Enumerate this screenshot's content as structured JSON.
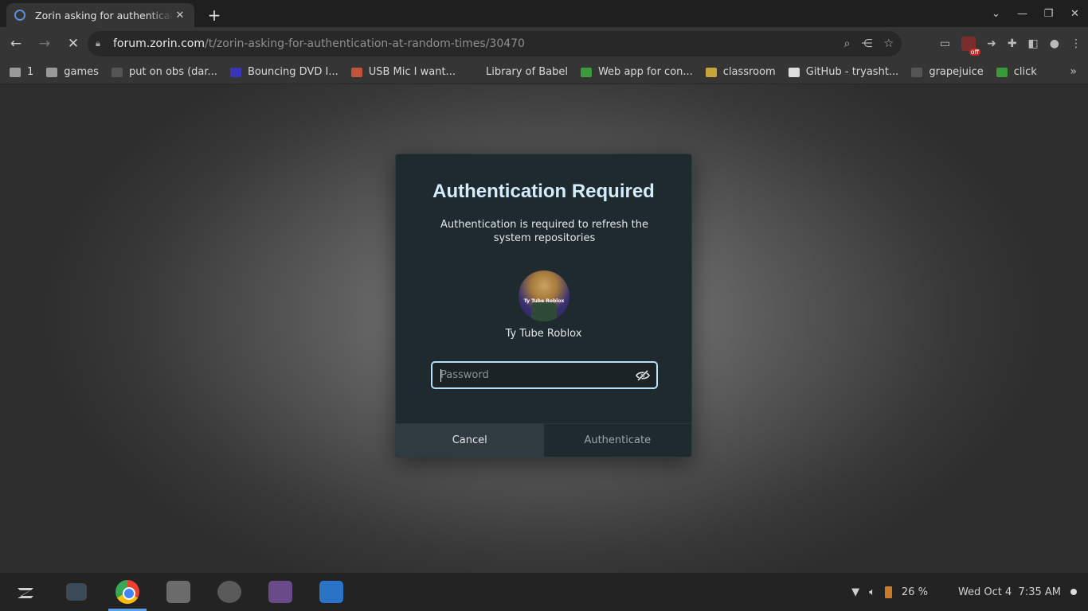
{
  "browser": {
    "tab_title": "Zorin asking for authentication at random times",
    "tab_close": "✕",
    "new_tab": "+",
    "url_domain": "forum.zorin.com",
    "url_path": "/t/zorin-asking-for-authentication-at-random-times/30470",
    "bookmarks": [
      {
        "label": "1",
        "color": "#9a9a9a"
      },
      {
        "label": "games",
        "color": "#9a9a9a"
      },
      {
        "label": "put on obs (dar...",
        "color": "#555555"
      },
      {
        "label": "Bouncing DVD I...",
        "color": "#3a34b8"
      },
      {
        "label": "USB Mic I want...",
        "color": "#c0533a"
      },
      {
        "label": "Library of Babel",
        "color": "#353535"
      },
      {
        "label": "Web app for con...",
        "color": "#3e9a3e"
      },
      {
        "label": "classroom",
        "color": "#c6a63c"
      },
      {
        "label": "GitHub - tryasht...",
        "color": "#dddddd"
      },
      {
        "label": "grapejuice",
        "color": "#555555"
      },
      {
        "label": "click",
        "color": "#3a9a3a"
      }
    ]
  },
  "dialog": {
    "title": "Authentication Required",
    "message": "Authentication is required to refresh the system repositories",
    "avatar_text": "Ty Tube Roblox",
    "user_name": "Ty Tube Roblox",
    "password_placeholder": "Password",
    "password_value": "",
    "cancel_label": "Cancel",
    "authenticate_label": "Authenticate"
  },
  "taskbar": {
    "battery": "26 %",
    "datetime": "Wed Oct 4  7:35 AM"
  },
  "colors": {
    "dialog_bg": "#1f2a2f",
    "title": "#d4ecfb",
    "focus_ring": "#b7dff6",
    "cancel_bg": "#2f3b41"
  }
}
